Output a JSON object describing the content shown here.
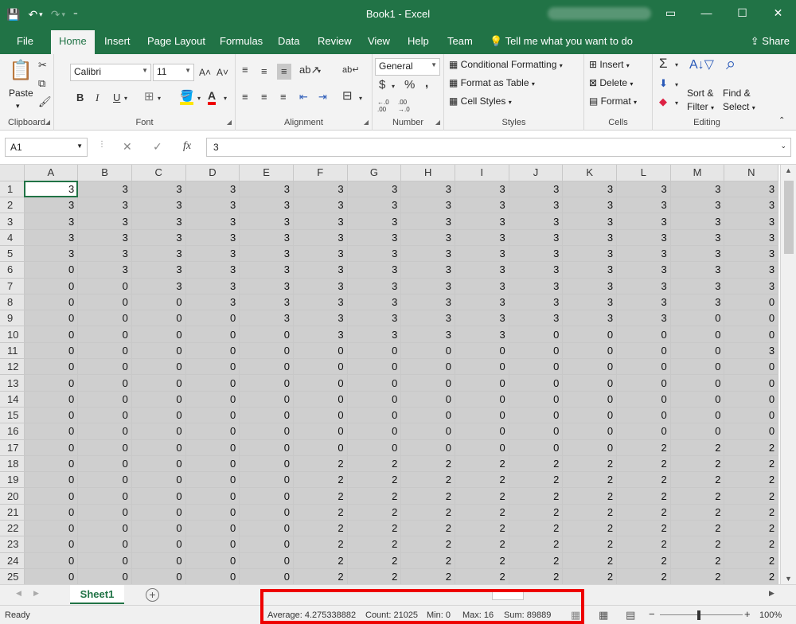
{
  "window": {
    "title": "Book1  -  Excel",
    "controls": [
      "▭",
      "—",
      "☐",
      "✕"
    ]
  },
  "qat": {
    "save": "💾",
    "undo": "↶",
    "undo_dd": "▾",
    "redo": "↷",
    "redo_dd": "▾",
    "more": "⁼"
  },
  "ribbon_tabs": [
    "File",
    "Home",
    "Insert",
    "Page Layout",
    "Formulas",
    "Data",
    "Review",
    "View",
    "Help",
    "Team"
  ],
  "tell_me": "Tell me what you want to do",
  "share": "Share",
  "clipboard": {
    "paste": "Paste",
    "group": "Clipboard"
  },
  "font": {
    "name": "Calibri",
    "size": "11",
    "grow": "A˄",
    "shrink": "A˅",
    "bold": "B",
    "italic": "I",
    "underline": "U",
    "color_letter": "A",
    "group": "Font"
  },
  "alignment": {
    "group": "Alignment"
  },
  "number": {
    "format": "General",
    "currency": "$",
    "percent": "%",
    "comma": ",",
    "inc_decimal": "←.0 .00",
    "dec_decimal": ".00 →.0",
    "group": "Number"
  },
  "styles": {
    "conditional": "Conditional Formatting",
    "table": "Format as Table",
    "cell_styles": "Cell Styles",
    "group": "Styles"
  },
  "cells": {
    "insert": "Insert",
    "delete": "Delete",
    "format": "Format",
    "group": "Cells"
  },
  "editing": {
    "sort": "Sort &",
    "filter": "Filter",
    "find": "Find &",
    "select": "Select",
    "group": "Editing"
  },
  "formula_bar": {
    "name_box": "A1",
    "cancel": "✕",
    "enter": "✓",
    "fx": "fx",
    "value": "3"
  },
  "columns": [
    "A",
    "B",
    "C",
    "D",
    "E",
    "F",
    "G",
    "H",
    "I",
    "J",
    "K",
    "L",
    "M",
    "N"
  ],
  "rows": [
    [
      1,
      [
        "3",
        "3",
        "3",
        "3",
        "3",
        "3",
        "3",
        "3",
        "3",
        "3",
        "3",
        "3",
        "3",
        "3"
      ]
    ],
    [
      2,
      [
        "3",
        "3",
        "3",
        "3",
        "3",
        "3",
        "3",
        "3",
        "3",
        "3",
        "3",
        "3",
        "3",
        "3"
      ]
    ],
    [
      3,
      [
        "3",
        "3",
        "3",
        "3",
        "3",
        "3",
        "3",
        "3",
        "3",
        "3",
        "3",
        "3",
        "3",
        "3"
      ]
    ],
    [
      4,
      [
        "3",
        "3",
        "3",
        "3",
        "3",
        "3",
        "3",
        "3",
        "3",
        "3",
        "3",
        "3",
        "3",
        "3"
      ]
    ],
    [
      5,
      [
        "3",
        "3",
        "3",
        "3",
        "3",
        "3",
        "3",
        "3",
        "3",
        "3",
        "3",
        "3",
        "3",
        "3"
      ]
    ],
    [
      6,
      [
        "0",
        "3",
        "3",
        "3",
        "3",
        "3",
        "3",
        "3",
        "3",
        "3",
        "3",
        "3",
        "3",
        "3"
      ]
    ],
    [
      7,
      [
        "0",
        "0",
        "3",
        "3",
        "3",
        "3",
        "3",
        "3",
        "3",
        "3",
        "3",
        "3",
        "3",
        "3"
      ]
    ],
    [
      8,
      [
        "0",
        "0",
        "0",
        "3",
        "3",
        "3",
        "3",
        "3",
        "3",
        "3",
        "3",
        "3",
        "3",
        "0"
      ]
    ],
    [
      9,
      [
        "0",
        "0",
        "0",
        "0",
        "3",
        "3",
        "3",
        "3",
        "3",
        "3",
        "3",
        "3",
        "0",
        "0"
      ]
    ],
    [
      10,
      [
        "0",
        "0",
        "0",
        "0",
        "0",
        "3",
        "3",
        "3",
        "3",
        "0",
        "0",
        "0",
        "0",
        "0"
      ]
    ],
    [
      11,
      [
        "0",
        "0",
        "0",
        "0",
        "0",
        "0",
        "0",
        "0",
        "0",
        "0",
        "0",
        "0",
        "0",
        "3"
      ]
    ],
    [
      12,
      [
        "0",
        "0",
        "0",
        "0",
        "0",
        "0",
        "0",
        "0",
        "0",
        "0",
        "0",
        "0",
        "0",
        "0"
      ]
    ],
    [
      13,
      [
        "0",
        "0",
        "0",
        "0",
        "0",
        "0",
        "0",
        "0",
        "0",
        "0",
        "0",
        "0",
        "0",
        "0"
      ]
    ],
    [
      14,
      [
        "0",
        "0",
        "0",
        "0",
        "0",
        "0",
        "0",
        "0",
        "0",
        "0",
        "0",
        "0",
        "0",
        "0"
      ]
    ],
    [
      15,
      [
        "0",
        "0",
        "0",
        "0",
        "0",
        "0",
        "0",
        "0",
        "0",
        "0",
        "0",
        "0",
        "0",
        "0"
      ]
    ],
    [
      16,
      [
        "0",
        "0",
        "0",
        "0",
        "0",
        "0",
        "0",
        "0",
        "0",
        "0",
        "0",
        "0",
        "0",
        "0"
      ]
    ],
    [
      17,
      [
        "0",
        "0",
        "0",
        "0",
        "0",
        "0",
        "0",
        "0",
        "0",
        "0",
        "0",
        "2",
        "2",
        "2"
      ]
    ],
    [
      18,
      [
        "0",
        "0",
        "0",
        "0",
        "0",
        "2",
        "2",
        "2",
        "2",
        "2",
        "2",
        "2",
        "2",
        "2"
      ]
    ],
    [
      19,
      [
        "0",
        "0",
        "0",
        "0",
        "0",
        "2",
        "2",
        "2",
        "2",
        "2",
        "2",
        "2",
        "2",
        "2"
      ]
    ],
    [
      20,
      [
        "0",
        "0",
        "0",
        "0",
        "0",
        "2",
        "2",
        "2",
        "2",
        "2",
        "2",
        "2",
        "2",
        "2"
      ]
    ],
    [
      21,
      [
        "0",
        "0",
        "0",
        "0",
        "0",
        "2",
        "2",
        "2",
        "2",
        "2",
        "2",
        "2",
        "2",
        "2"
      ]
    ],
    [
      22,
      [
        "0",
        "0",
        "0",
        "0",
        "0",
        "2",
        "2",
        "2",
        "2",
        "2",
        "2",
        "2",
        "2",
        "2"
      ]
    ],
    [
      23,
      [
        "0",
        "0",
        "0",
        "0",
        "0",
        "2",
        "2",
        "2",
        "2",
        "2",
        "2",
        "2",
        "2",
        "2"
      ]
    ],
    [
      24,
      [
        "0",
        "0",
        "0",
        "0",
        "0",
        "2",
        "2",
        "2",
        "2",
        "2",
        "2",
        "2",
        "2",
        "2"
      ]
    ],
    [
      25,
      [
        "0",
        "0",
        "0",
        "0",
        "0",
        "2",
        "2",
        "2",
        "2",
        "2",
        "2",
        "2",
        "2",
        "2"
      ]
    ]
  ],
  "sheet": {
    "name": "Sheet1",
    "add": "+"
  },
  "status": {
    "ready": "Ready",
    "average": "Average: 4.275338882",
    "count": "Count: 21025",
    "min": "Min: 0",
    "max": "Max: 16",
    "sum": "Sum: 89889",
    "zoom": "100%",
    "zoom_minus": "−",
    "zoom_plus": "+"
  },
  "colors": {
    "excel_green": "#217346",
    "highlight": "#ee0000",
    "selection": "#cfcfcf"
  }
}
